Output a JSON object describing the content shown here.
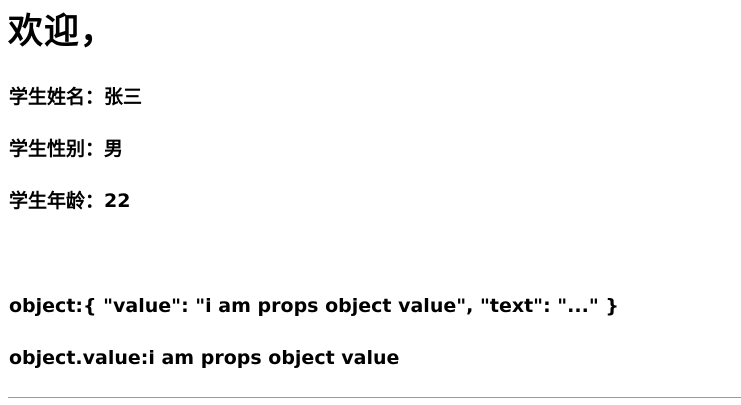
{
  "header": {
    "title": "欢迎，"
  },
  "student": {
    "name_label": "学生姓名：",
    "name_value": "张三",
    "gender_label": "学生性别：",
    "gender_value": "男",
    "age_label": "学生年龄：",
    "age_value": "22"
  },
  "props": {
    "object_label": "object:",
    "object_value": "{ \"value\": \"i am props object value\", \"text\": \"...\" }",
    "object_value_label": "object.value:",
    "object_value_value": "i am props object value"
  }
}
